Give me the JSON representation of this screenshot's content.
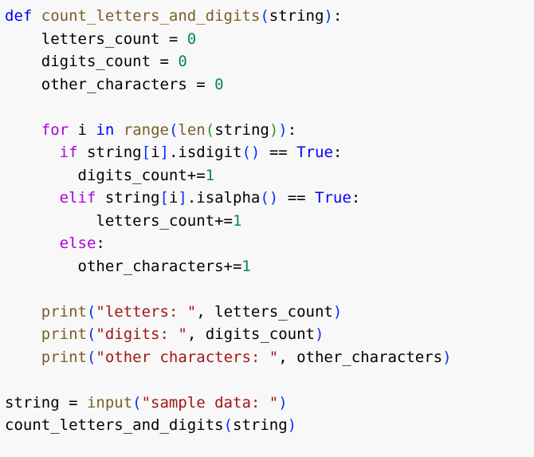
{
  "editor": {
    "background": "#f8f8f8",
    "theme_colors": {
      "keyword": "#0000ff",
      "control": "#af00db",
      "function": "#795e26",
      "string": "#a31515",
      "number": "#098658",
      "bracket_level1": "#0431fa",
      "bracket_level2": "#319331",
      "bracket_level3": "#7b3814",
      "plain": "#000000"
    },
    "lines": [
      [
        {
          "text": "def",
          "cls": "keyword"
        },
        {
          "text": " ",
          "cls": "plain"
        },
        {
          "text": "count_letters_and_digits",
          "cls": "func"
        },
        {
          "text": "(",
          "cls": "paren1"
        },
        {
          "text": "string",
          "cls": "plain"
        },
        {
          "text": ")",
          "cls": "paren1"
        },
        {
          "text": ":",
          "cls": "plain"
        }
      ],
      [
        {
          "text": "    letters_count = ",
          "cls": "plain"
        },
        {
          "text": "0",
          "cls": "number"
        }
      ],
      [
        {
          "text": "    digits_count = ",
          "cls": "plain"
        },
        {
          "text": "0",
          "cls": "number"
        }
      ],
      [
        {
          "text": "    other_characters = ",
          "cls": "plain"
        },
        {
          "text": "0",
          "cls": "number"
        }
      ],
      [
        {
          "text": "",
          "cls": "plain"
        }
      ],
      [
        {
          "text": "    ",
          "cls": "plain"
        },
        {
          "text": "for",
          "cls": "control"
        },
        {
          "text": " i ",
          "cls": "plain"
        },
        {
          "text": "in",
          "cls": "keyword"
        },
        {
          "text": " ",
          "cls": "plain"
        },
        {
          "text": "range",
          "cls": "func"
        },
        {
          "text": "(",
          "cls": "paren1"
        },
        {
          "text": "len",
          "cls": "func"
        },
        {
          "text": "(",
          "cls": "paren2"
        },
        {
          "text": "string",
          "cls": "plain"
        },
        {
          "text": ")",
          "cls": "paren2"
        },
        {
          "text": ")",
          "cls": "paren1"
        },
        {
          "text": ":",
          "cls": "plain"
        }
      ],
      [
        {
          "text": "      ",
          "cls": "plain"
        },
        {
          "text": "if",
          "cls": "control"
        },
        {
          "text": " string",
          "cls": "plain"
        },
        {
          "text": "[",
          "cls": "paren1"
        },
        {
          "text": "i",
          "cls": "plain"
        },
        {
          "text": "]",
          "cls": "paren1"
        },
        {
          "text": ".isdigit",
          "cls": "plain"
        },
        {
          "text": "()",
          "cls": "paren1"
        },
        {
          "text": " == ",
          "cls": "plain"
        },
        {
          "text": "True",
          "cls": "keyword"
        },
        {
          "text": ":",
          "cls": "plain"
        }
      ],
      [
        {
          "text": "        digits_count+=",
          "cls": "plain"
        },
        {
          "text": "1",
          "cls": "number"
        }
      ],
      [
        {
          "text": "      ",
          "cls": "plain"
        },
        {
          "text": "elif",
          "cls": "control"
        },
        {
          "text": " string",
          "cls": "plain"
        },
        {
          "text": "[",
          "cls": "paren1"
        },
        {
          "text": "i",
          "cls": "plain"
        },
        {
          "text": "]",
          "cls": "paren1"
        },
        {
          "text": ".isalpha",
          "cls": "plain"
        },
        {
          "text": "()",
          "cls": "paren1"
        },
        {
          "text": " == ",
          "cls": "plain"
        },
        {
          "text": "True",
          "cls": "keyword"
        },
        {
          "text": ":",
          "cls": "plain"
        }
      ],
      [
        {
          "text": "          letters_count+=",
          "cls": "plain"
        },
        {
          "text": "1",
          "cls": "number"
        }
      ],
      [
        {
          "text": "      ",
          "cls": "plain"
        },
        {
          "text": "else",
          "cls": "control"
        },
        {
          "text": ":",
          "cls": "plain"
        }
      ],
      [
        {
          "text": "        other_characters+=",
          "cls": "plain"
        },
        {
          "text": "1",
          "cls": "number"
        }
      ],
      [
        {
          "text": "",
          "cls": "plain"
        }
      ],
      [
        {
          "text": "    ",
          "cls": "plain"
        },
        {
          "text": "print",
          "cls": "func"
        },
        {
          "text": "(",
          "cls": "paren1"
        },
        {
          "text": "\"letters: \"",
          "cls": "string"
        },
        {
          "text": ", letters_count",
          "cls": "plain"
        },
        {
          "text": ")",
          "cls": "paren1"
        }
      ],
      [
        {
          "text": "    ",
          "cls": "plain"
        },
        {
          "text": "print",
          "cls": "func"
        },
        {
          "text": "(",
          "cls": "paren1"
        },
        {
          "text": "\"digits: \"",
          "cls": "string"
        },
        {
          "text": ", digits_count",
          "cls": "plain"
        },
        {
          "text": ")",
          "cls": "paren1"
        }
      ],
      [
        {
          "text": "    ",
          "cls": "plain"
        },
        {
          "text": "print",
          "cls": "func"
        },
        {
          "text": "(",
          "cls": "paren1"
        },
        {
          "text": "\"other characters: \"",
          "cls": "string"
        },
        {
          "text": ", other_characters",
          "cls": "plain"
        },
        {
          "text": ")",
          "cls": "paren1"
        }
      ],
      [
        {
          "text": "",
          "cls": "plain"
        }
      ],
      [
        {
          "text": "string = ",
          "cls": "plain"
        },
        {
          "text": "input",
          "cls": "func"
        },
        {
          "text": "(",
          "cls": "paren1"
        },
        {
          "text": "\"sample data: \"",
          "cls": "string"
        },
        {
          "text": ")",
          "cls": "paren1"
        }
      ],
      [
        {
          "text": "count_letters_and_digits",
          "cls": "plain"
        },
        {
          "text": "(",
          "cls": "paren1"
        },
        {
          "text": "string",
          "cls": "plain"
        },
        {
          "text": ")",
          "cls": "paren1"
        }
      ]
    ]
  }
}
